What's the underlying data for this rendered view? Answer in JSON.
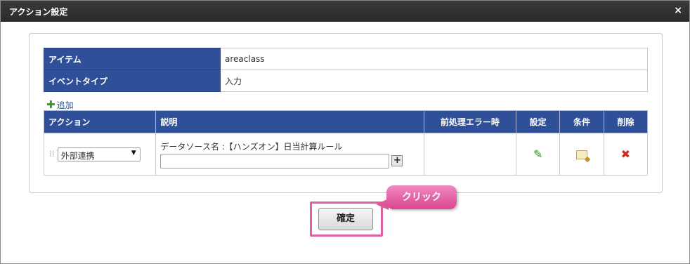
{
  "window": {
    "title": "アクション設定",
    "close_icon": "×"
  },
  "info_rows": [
    {
      "label": "アイテム",
      "value": "areaclass"
    },
    {
      "label": "イベントタイプ",
      "value": "入力"
    }
  ],
  "add_link": {
    "icon": "plus-icon",
    "label": "追加"
  },
  "action_table": {
    "headers": {
      "action": "アクション",
      "description": "説明",
      "pre_error": "前処理エラー時",
      "settings": "設定",
      "condition": "条件",
      "delete": "削除"
    },
    "rows": [
      {
        "action_select": "外部連携",
        "description_text": "データソース名 :【ハンズオン】日当計算ルール",
        "description_input": "",
        "pre_error": ""
      }
    ]
  },
  "confirm_button": "確定",
  "callout": "クリック",
  "colors": {
    "header_blue": "#2f4f98",
    "highlight_pink": "#e05f9e",
    "title_bar": "#333333"
  }
}
